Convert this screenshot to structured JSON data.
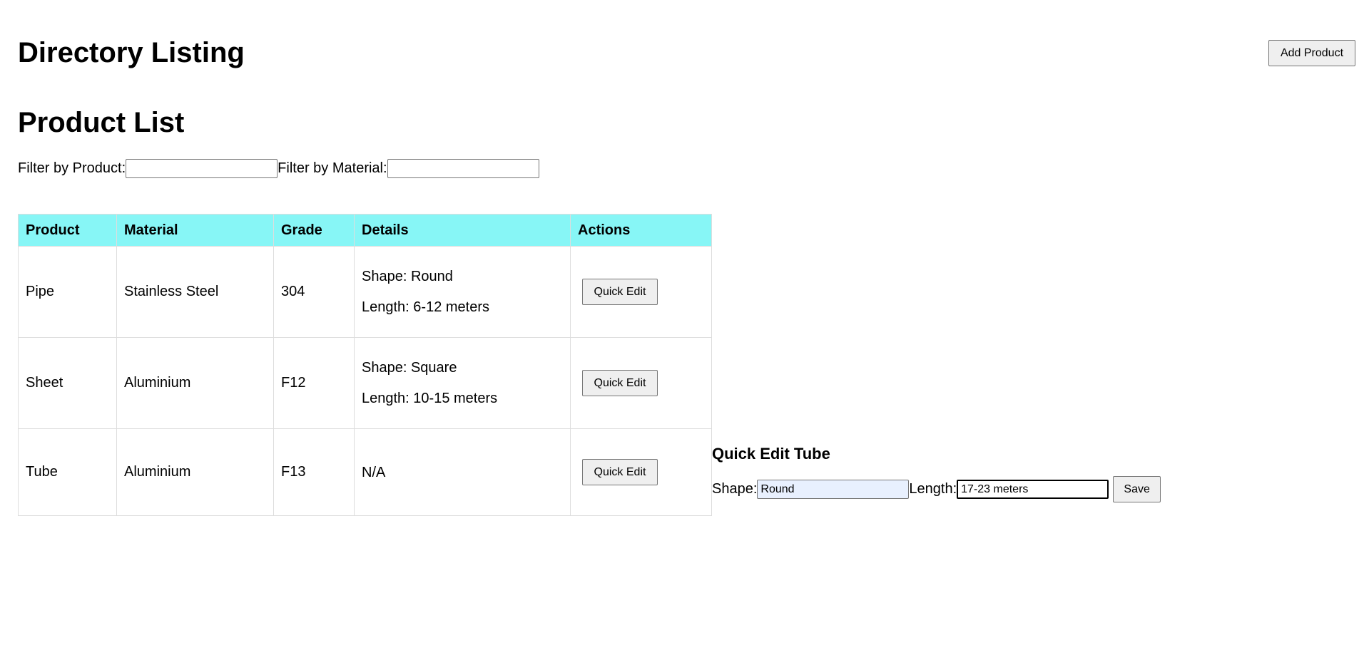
{
  "header": {
    "title": "Directory Listing",
    "add_button_label": "Add Product"
  },
  "product_list": {
    "title": "Product List",
    "filters": {
      "product_label": "Filter by Product:",
      "product_value": "",
      "material_label": "Filter by Material:",
      "material_value": ""
    },
    "columns": [
      "Product",
      "Material",
      "Grade",
      "Details",
      "Actions"
    ],
    "rows": [
      {
        "product": "Pipe",
        "material": "Stainless Steel",
        "grade": "304",
        "details": [
          "Shape: Round",
          "Length: 6-12 meters"
        ],
        "action_label": "Quick Edit"
      },
      {
        "product": "Sheet",
        "material": "Aluminium",
        "grade": "F12",
        "details": [
          "Shape: Square",
          "Length: 10-15 meters"
        ],
        "action_label": "Quick Edit"
      },
      {
        "product": "Tube",
        "material": "Aluminium",
        "grade": "F13",
        "details": [
          "N/A"
        ],
        "action_label": "Quick Edit"
      }
    ]
  },
  "quick_edit": {
    "title": "Quick Edit Tube",
    "shape_label": "Shape:",
    "shape_value": "Round",
    "length_label": "Length:",
    "length_value": "17-23 meters",
    "save_label": "Save"
  },
  "colors": {
    "table_header_bg": "#87f6f6",
    "table_border": "#dddddd",
    "autofill_bg": "#e8f0fe",
    "button_bg": "#efefef"
  }
}
